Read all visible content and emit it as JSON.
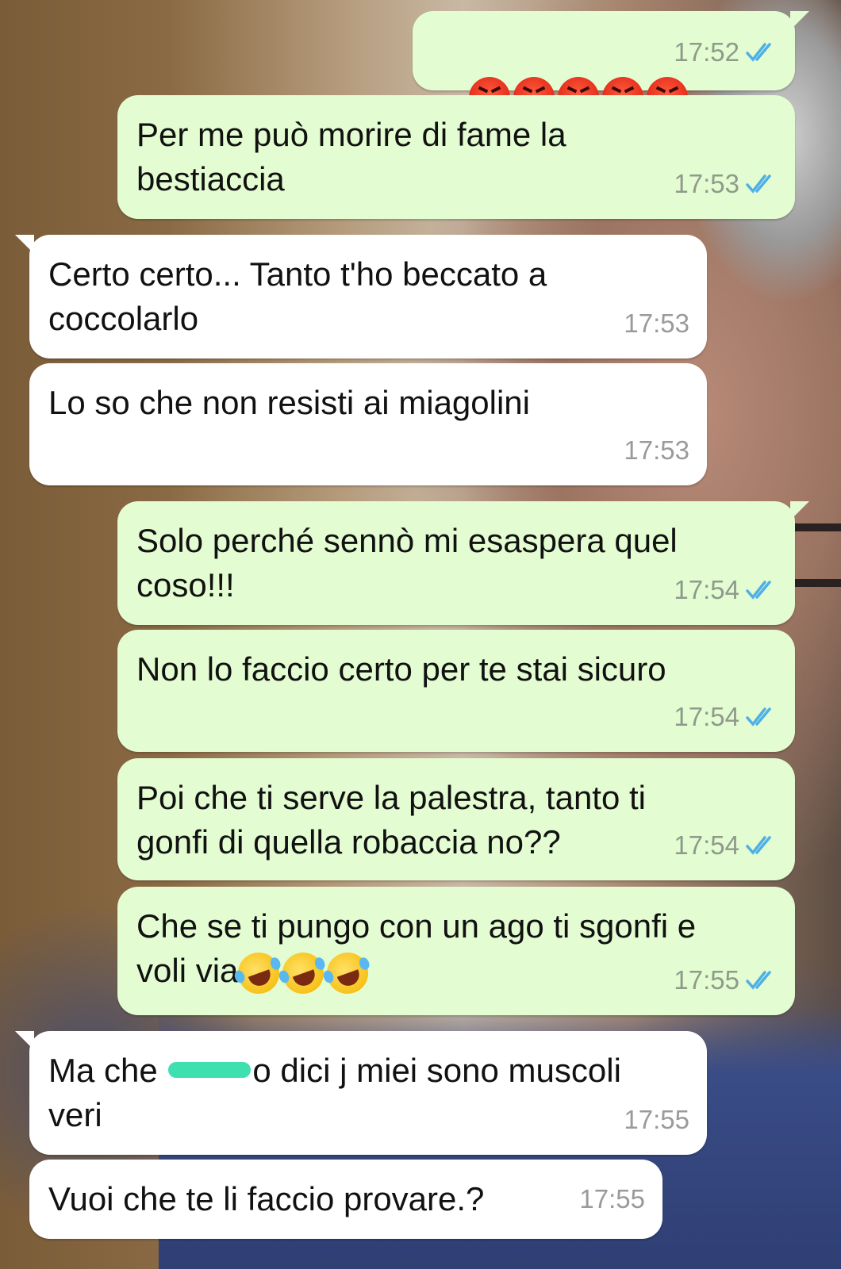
{
  "messages": [
    {
      "dir": "out",
      "text": "",
      "emoji": [
        "angry",
        "angry",
        "angry",
        "angry",
        "angry"
      ],
      "time": "17:52",
      "read": true
    },
    {
      "dir": "out",
      "text": "Per me può morire di fame la\nbestiaccia",
      "time": "17:53",
      "read": true
    },
    {
      "dir": "in",
      "text": "Certo certo... Tanto t'ho beccato a\ncoccolarlo",
      "time": "17:53"
    },
    {
      "dir": "in",
      "text": "Lo so che non resisti ai miagolini",
      "time": "17:53"
    },
    {
      "dir": "out",
      "text": "Solo perché sennò mi esaspera quel\ncoso!!!",
      "time": "17:54",
      "read": true
    },
    {
      "dir": "out",
      "text": "Non lo faccio certo per te stai sicuro",
      "time": "17:54",
      "read": true
    },
    {
      "dir": "out",
      "text": "Poi che ti serve la palestra, tanto ti\ngonfi di quella robaccia no??",
      "time": "17:54",
      "read": true
    },
    {
      "dir": "out",
      "text": "Che se ti pungo con un ago ti sgonfi e\nvoli via",
      "emoji_after": [
        "rofl",
        "rofl",
        "rofl"
      ],
      "time": "17:55",
      "read": true
    },
    {
      "dir": "in",
      "text_before": "Ma che ",
      "text_after": "o dici j miei sono muscoli\nveri",
      "censored": true,
      "time": "17:55"
    },
    {
      "dir": "in",
      "text": "Vuoi che te li faccio provare.?",
      "time": "17:55"
    }
  ],
  "colors": {
    "outgoing": "#e3fcd1",
    "incoming": "#ffffff",
    "read_ticks": "#4fb0e6",
    "censor": "#3ee0b0"
  }
}
